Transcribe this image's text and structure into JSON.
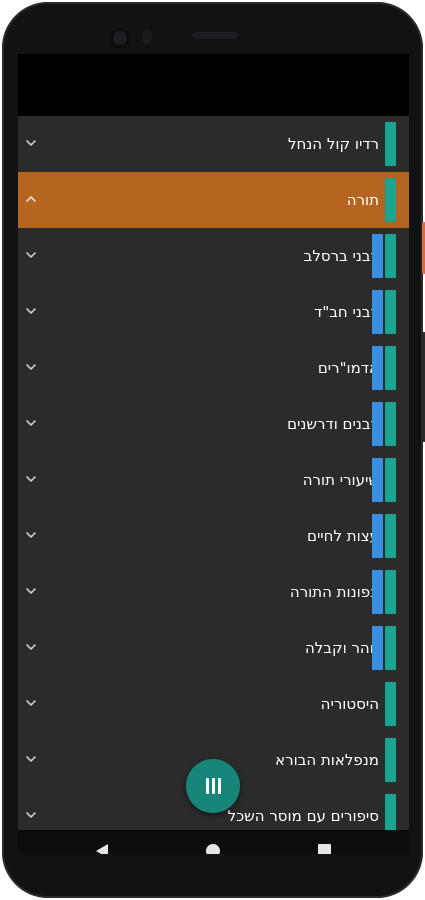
{
  "categories": [
    {
      "label": "רדיו קול הנחל",
      "expanded": false,
      "selected": false,
      "accent": [
        "teal"
      ]
    },
    {
      "label": "תורה",
      "expanded": true,
      "selected": true,
      "accent": [
        "teal"
      ]
    },
    {
      "label": "רבני ברסלב",
      "expanded": false,
      "selected": false,
      "accent": [
        "blue",
        "teal"
      ]
    },
    {
      "label": "רבני חב\"ד",
      "expanded": false,
      "selected": false,
      "accent": [
        "blue",
        "teal"
      ]
    },
    {
      "label": "אדמו\"רים",
      "expanded": false,
      "selected": false,
      "accent": [
        "blue",
        "teal"
      ]
    },
    {
      "label": "רבנים ודרשנים",
      "expanded": false,
      "selected": false,
      "accent": [
        "blue",
        "teal"
      ]
    },
    {
      "label": "שיעורי תורה",
      "expanded": false,
      "selected": false,
      "accent": [
        "blue",
        "teal"
      ]
    },
    {
      "label": "עצות לחיים",
      "expanded": false,
      "selected": false,
      "accent": [
        "blue",
        "teal"
      ]
    },
    {
      "label": "צפונות התורה",
      "expanded": false,
      "selected": false,
      "accent": [
        "blue",
        "teal"
      ]
    },
    {
      "label": "זוהר וקבלה",
      "expanded": false,
      "selected": false,
      "accent": [
        "blue",
        "teal"
      ]
    },
    {
      "label": "היסטוריה",
      "expanded": false,
      "selected": false,
      "accent": [
        "teal"
      ]
    },
    {
      "label": "מנפלאות הבורא",
      "expanded": false,
      "selected": false,
      "accent": [
        "teal"
      ]
    },
    {
      "label": "סיפורים עם מוסר השכל",
      "expanded": false,
      "selected": false,
      "accent": [
        "teal"
      ]
    }
  ],
  "colors": {
    "selected_row": "#b5651d",
    "background": "#2b2b2b",
    "teal_accent": "#1aa591",
    "blue_accent": "#3b8fe0",
    "fab": "#17857a"
  },
  "icons": {
    "collapsed": "chevron-down-icon",
    "expanded": "chevron-up-icon",
    "fab": "pause-icon",
    "nav_back": "back-triangle-icon",
    "nav_home": "home-circle-icon",
    "nav_recent": "recent-square-icon"
  }
}
